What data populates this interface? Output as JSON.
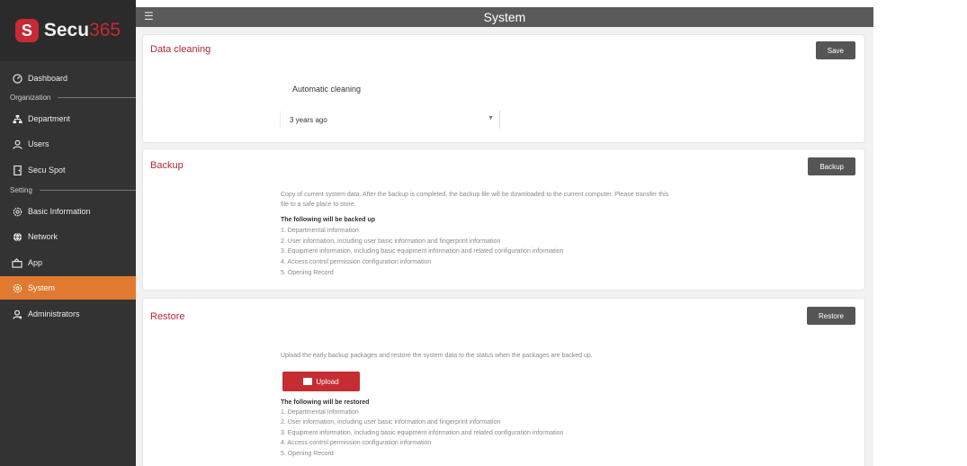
{
  "brand": {
    "mark": "S",
    "name_part1": "Secu",
    "name_part2": "365"
  },
  "topbar": {
    "title": "System",
    "menu_icon": "hamburger-icon"
  },
  "sidebar": {
    "items": [
      {
        "label": "Dashboard",
        "icon": "dashboard-icon"
      },
      {
        "label": "Department",
        "icon": "org-chart-icon"
      },
      {
        "label": "Users",
        "icon": "user-icon"
      },
      {
        "label": "Secu Spot",
        "icon": "door-icon"
      },
      {
        "label": "Basic Information",
        "icon": "gear-icon"
      },
      {
        "label": "Network",
        "icon": "globe-icon"
      },
      {
        "label": "App",
        "icon": "app-icon"
      },
      {
        "label": "System",
        "icon": "gear-icon",
        "active": true
      },
      {
        "label": "Administrators",
        "icon": "admin-user-icon"
      }
    ],
    "groups": {
      "organization": "Organization",
      "setting": "Setting"
    }
  },
  "cleaning": {
    "title": "Data cleaning",
    "save_label": "Save",
    "field_label": "Automatic cleaning",
    "select_value": "3 years ago"
  },
  "backup": {
    "title": "Backup",
    "button_label": "Backup",
    "desc_line1": "Copy of current system data. After the backup is completed, the backup file will be downloaded to the current computer. Please transfer this",
    "desc_line2": "file to a safe place to store.",
    "list_title": "The following will be backed up",
    "items": [
      "1. Departmental Information",
      "2. User information, including user basic information and fingerprint information",
      "3. Equipment information, including basic equipment information and related configuration information",
      "4. Access control permission configuration information",
      "5. Opening Record"
    ]
  },
  "restore": {
    "title": "Restore",
    "button_label": "Restore",
    "desc": "Upload the early backup packages and restore the system data to the status when the packages are backed up.",
    "upload_label": "Upload",
    "list_title": "The following will be restored",
    "items": [
      "1. Departmental Information",
      "2. User information, including user basic information and fingerprint information",
      "3. Equipment information, including basic equipment information and related configuration information",
      "4. Access control permission configuration information",
      "5. Opening Record"
    ]
  },
  "colors": {
    "accent": "#c62a35",
    "active_nav": "#e07a30",
    "sidebar": "#333333"
  }
}
